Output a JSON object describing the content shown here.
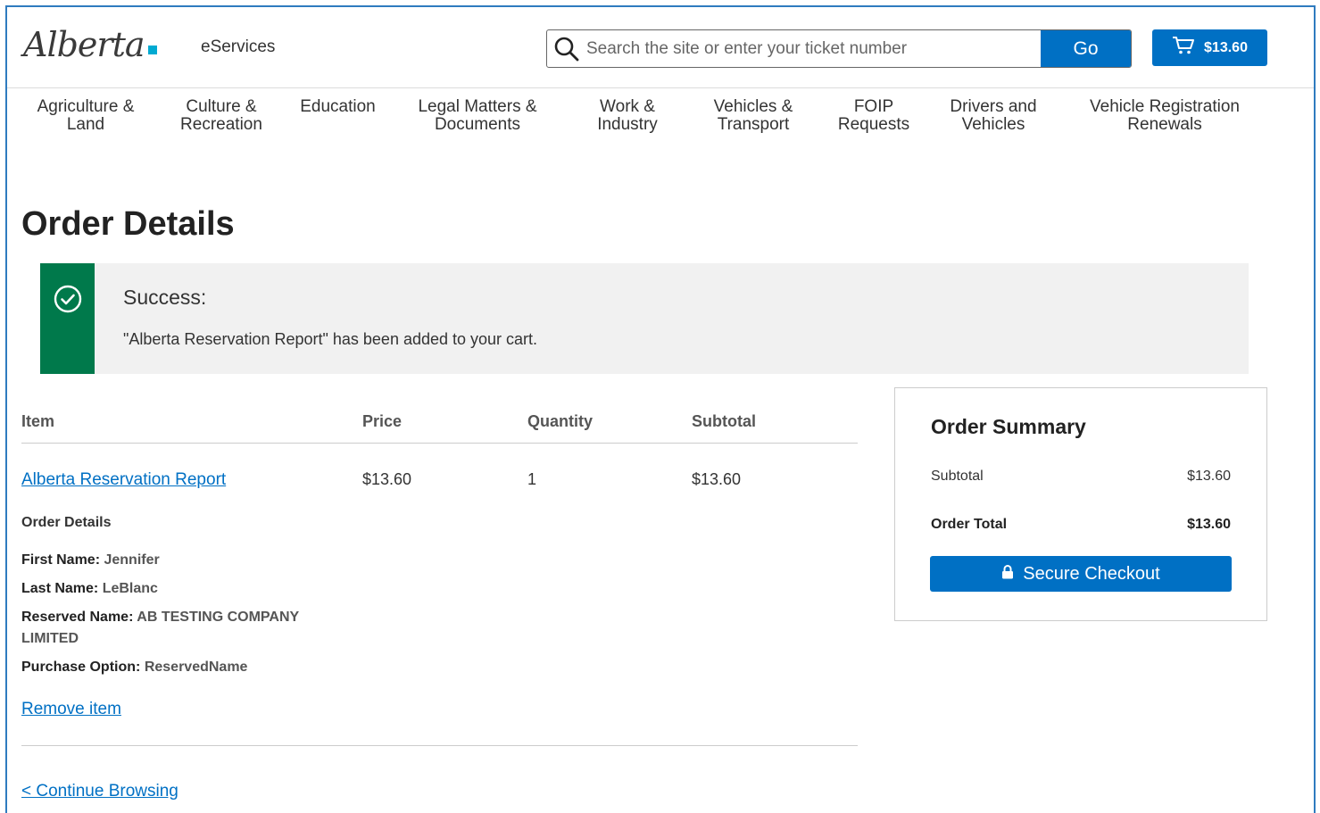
{
  "header": {
    "logo_text": "Alberta",
    "site_name": "eServices",
    "search_placeholder": "Search the site or enter your ticket number",
    "go_label": "Go",
    "cart_total": "$13.60"
  },
  "nav": {
    "items": [
      {
        "line1": "Agriculture &",
        "line2": "Land"
      },
      {
        "line1": "Culture &",
        "line2": "Recreation"
      },
      {
        "line1": "Education",
        "line2": ""
      },
      {
        "line1": "Legal Matters &",
        "line2": "Documents"
      },
      {
        "line1": "Work &",
        "line2": "Industry"
      },
      {
        "line1": "Vehicles &",
        "line2": "Transport"
      },
      {
        "line1": "FOIP",
        "line2": "Requests"
      },
      {
        "line1": "Drivers and",
        "line2": "Vehicles"
      },
      {
        "line1": "Vehicle Registration",
        "line2": "Renewals"
      }
    ]
  },
  "page": {
    "title": "Order Details"
  },
  "callout": {
    "title": "Success:",
    "message": "\"Alberta Reservation Report\" has been added to your cart."
  },
  "cart_table": {
    "headers": {
      "item": "Item",
      "price": "Price",
      "quantity": "Quantity",
      "subtotal": "Subtotal"
    },
    "row": {
      "item": "Alberta Reservation Report",
      "price": "$13.60",
      "quantity": "1",
      "subtotal": "$13.60"
    },
    "details_title": "Order Details",
    "details": [
      {
        "label": "First Name:",
        "value": "Jennifer"
      },
      {
        "label": "Last Name:",
        "value": "LeBlanc"
      },
      {
        "label": "Reserved Name:",
        "value": "AB TESTING COMPANY"
      },
      {
        "label": "",
        "value": "LIMITED"
      },
      {
        "label": "Purchase Option:",
        "value": "ReservedName"
      }
    ],
    "remove_label": "Remove item",
    "continue_label": "< Continue Browsing"
  },
  "summary": {
    "title": "Order Summary",
    "subtotal_label": "Subtotal",
    "subtotal_value": "$13.60",
    "total_label": "Order Total",
    "total_value": "$13.60",
    "checkout_label": "Secure Checkout"
  },
  "colors": {
    "primary": "#0070c4",
    "success": "#00794b",
    "callout_bg": "#f1f1f1"
  }
}
